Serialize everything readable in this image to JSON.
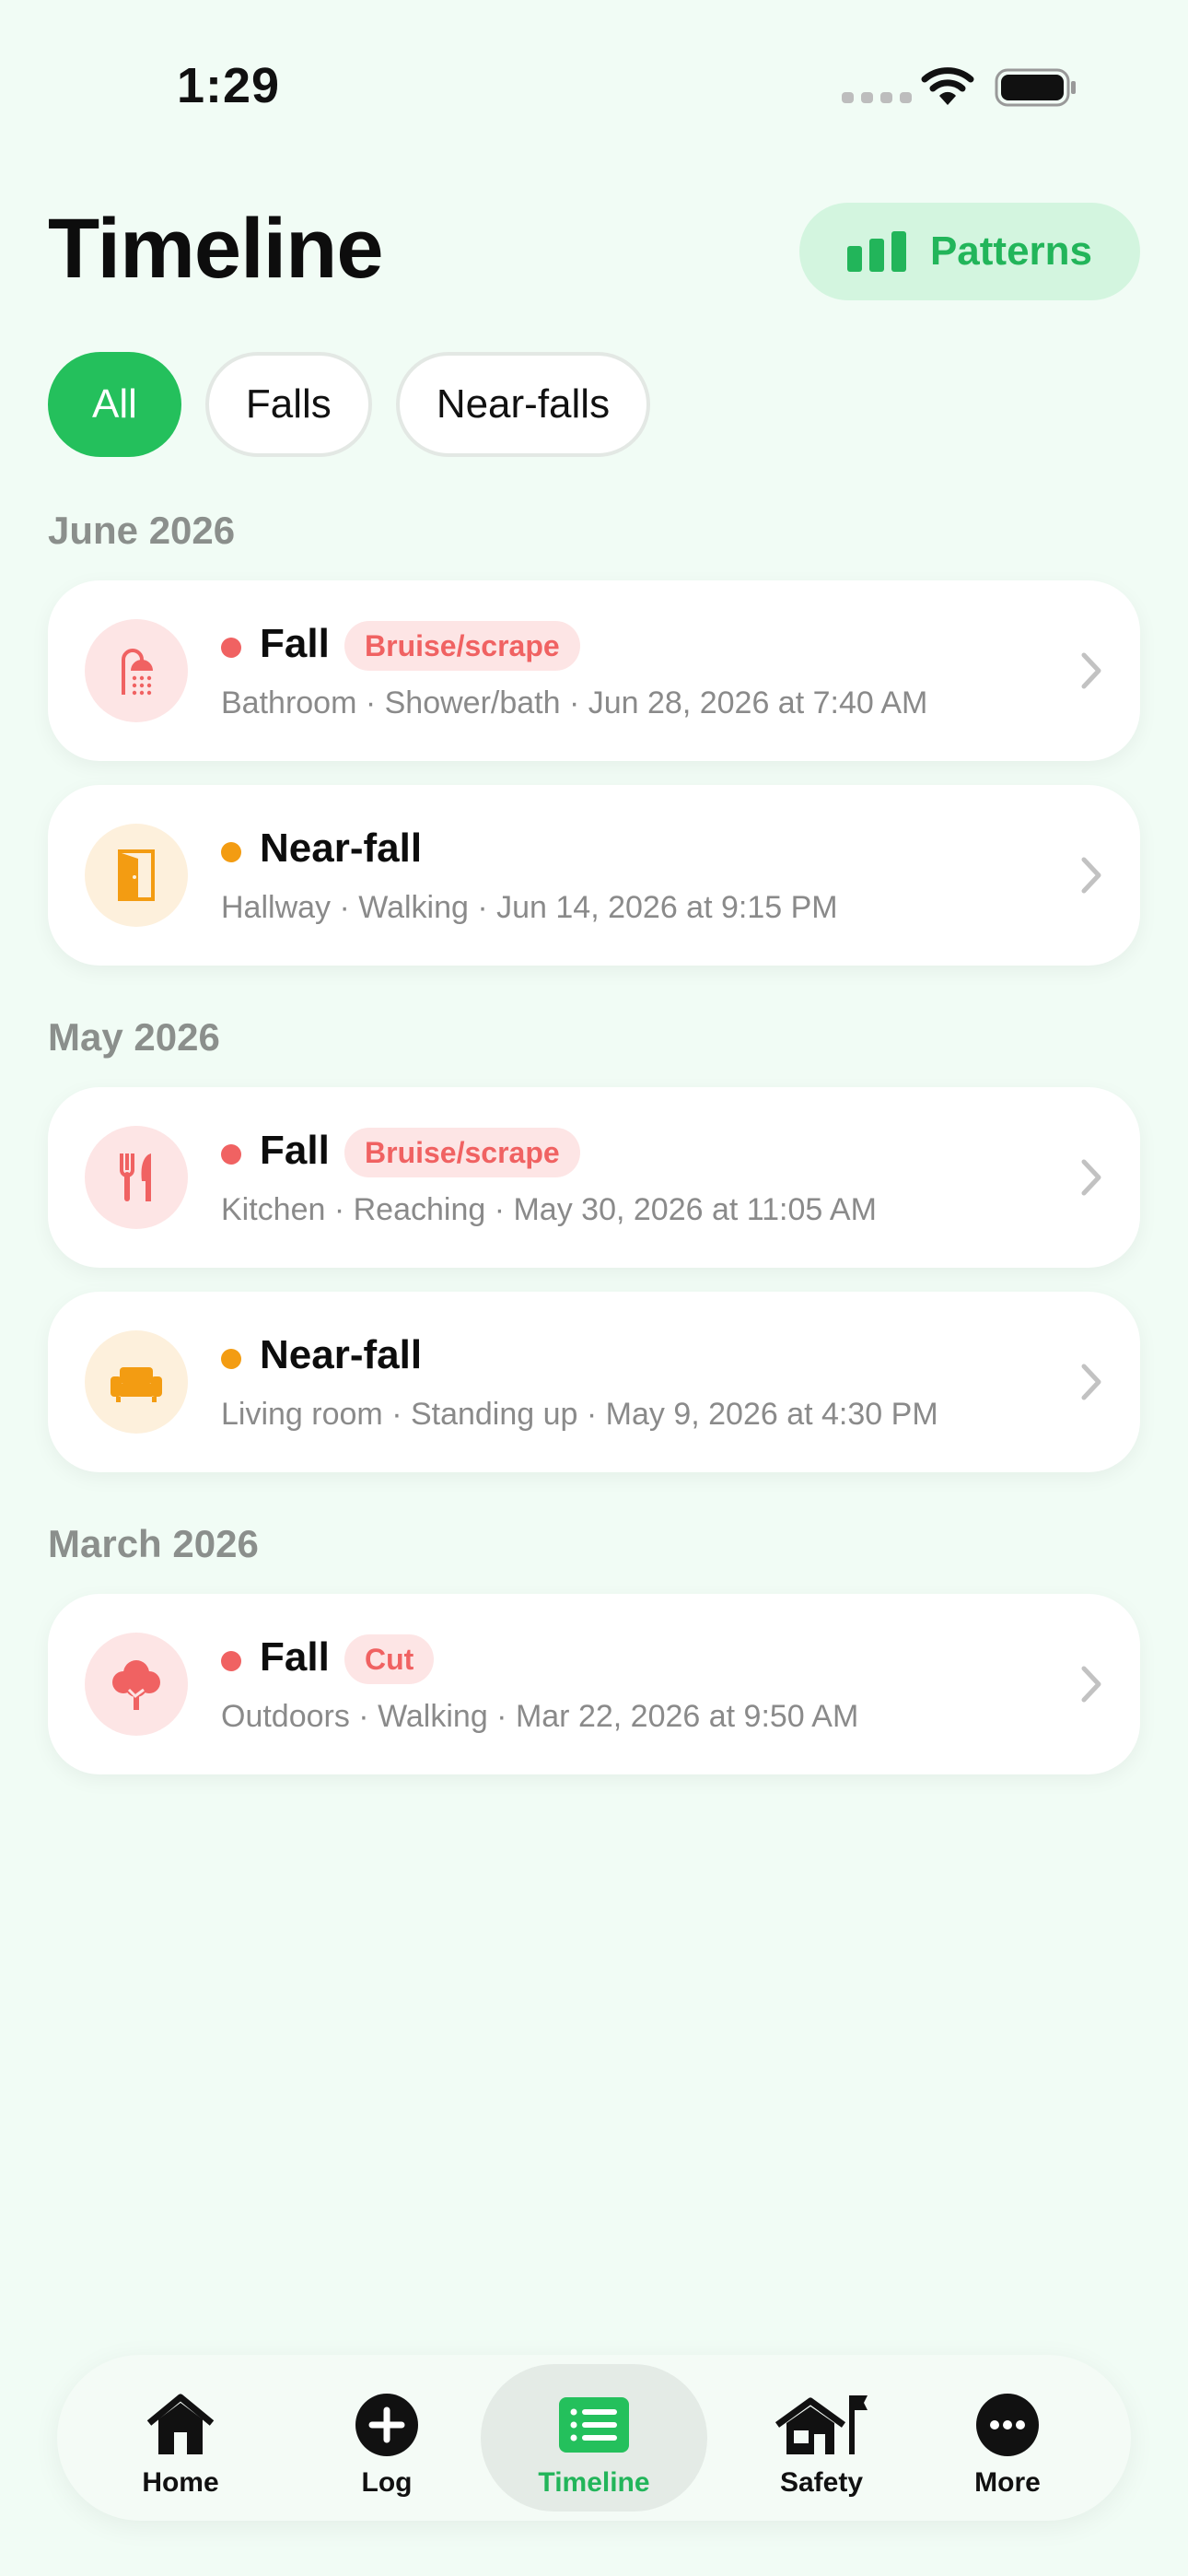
{
  "status_bar": {
    "time": "1:29"
  },
  "header": {
    "title": "Timeline",
    "patterns_label": "Patterns"
  },
  "filters": [
    {
      "label": "All",
      "active": true
    },
    {
      "label": "Falls",
      "active": false
    },
    {
      "label": "Near-falls",
      "active": false
    }
  ],
  "sections": [
    {
      "heading": "June 2026",
      "entries": [
        {
          "type": "Fall",
          "badge": "Bruise/scrape",
          "meta": "Bathroom · Shower/bath · Jun 28, 2026 at 7:40 AM",
          "icon": "shower-icon"
        },
        {
          "type": "Near-fall",
          "badge": "",
          "meta": "Hallway · Walking · Jun 14, 2026 at 9:15 PM",
          "icon": "door-icon"
        }
      ]
    },
    {
      "heading": "May 2026",
      "entries": [
        {
          "type": "Fall",
          "badge": "Bruise/scrape",
          "meta": "Kitchen · Reaching · May 30, 2026 at 11:05 AM",
          "icon": "utensils-icon"
        },
        {
          "type": "Near-fall",
          "badge": "",
          "meta": "Living room · Standing up · May 9, 2026 at 4:30 PM",
          "icon": "sofa-icon"
        }
      ]
    },
    {
      "heading": "March 2026",
      "entries": [
        {
          "type": "Fall",
          "badge": "Cut",
          "meta": "Outdoors · Walking · Mar 22, 2026 at 9:50 AM",
          "icon": "tree-icon"
        }
      ]
    }
  ],
  "tabs": [
    {
      "label": "Home",
      "icon": "home-icon"
    },
    {
      "label": "Log",
      "icon": "plus-circle-icon"
    },
    {
      "label": "Timeline",
      "icon": "list-icon",
      "active": true
    },
    {
      "label": "Safety",
      "icon": "house-flag-icon"
    },
    {
      "label": "More",
      "icon": "ellipsis-circle-icon"
    }
  ],
  "colors": {
    "accent": "#24c05c",
    "fall": "#f06262",
    "near_fall": "#f39c12",
    "background": "#f1fcf5"
  }
}
